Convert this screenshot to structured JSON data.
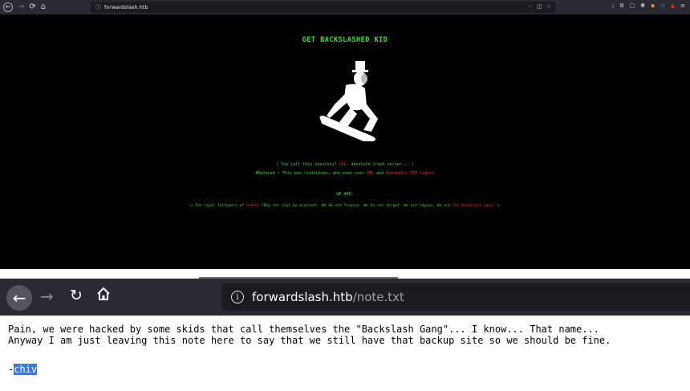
{
  "top_browser": {
    "url": "forwardslash.htb",
    "icons": [
      "back-icon",
      "forward-icon",
      "reload-icon",
      "home-icon",
      "info-icon",
      "more-icon",
      "pocket-icon",
      "star-icon",
      "download-icon",
      "library-icon",
      "sidebar-icon",
      "extension-icon",
      "menu-icon"
    ]
  },
  "site": {
    "header": "GET BACKSLASHED KID",
    "line1_a": "|  You call this security? ",
    "line1_lol": "LOL",
    "line1_b": ", absolute trash server...  |",
    "line2_a": "#Defaced • This was ridiculous, who even uses ",
    "line2_xml": "XML",
    "line2_and": " and ",
    "line2_ftp": "Automatic FTP logins",
    "we_are": "WE ARE:",
    "loyal_a": "-> The loyal followers of ",
    "loyal_sharon": "Sharon",
    "loyal_b": " (May her soul be blessed). We do not forgive. We do not forget. We are legion. We are ",
    "loyal_gang": "The Backslash Gang.",
    "loyal_c": " <-",
    "colors": {
      "green": "#35e335",
      "red": "#ff2a2a",
      "background": "#000000"
    }
  },
  "bottom_browser": {
    "url_host": "forwardslash.htb",
    "url_path": "/note.txt",
    "icons": [
      "back-icon",
      "forward-icon",
      "reload-icon",
      "home-icon",
      "info-icon"
    ]
  },
  "note": {
    "line1": "Pain, we were hacked by some skids that call themselves the \"Backslash Gang\"... I know... That name...",
    "line2": "Anyway I am just leaving this note here to say that we still have that backup site so we should be fine.",
    "sig_dash": "-",
    "sig_name": "chiv"
  }
}
